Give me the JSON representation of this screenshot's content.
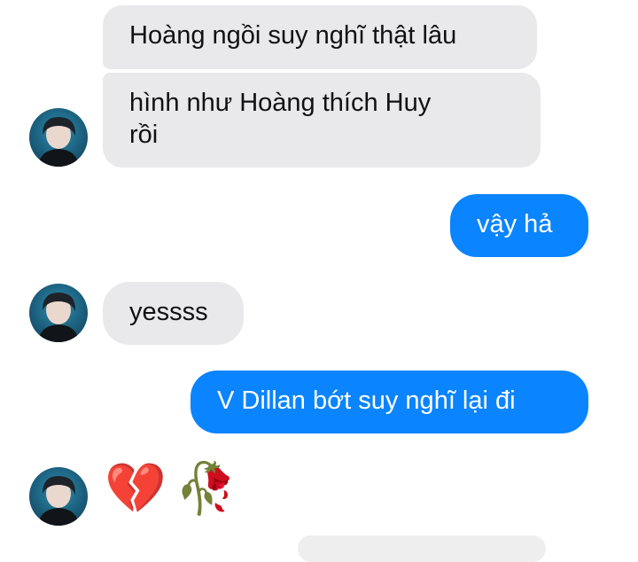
{
  "colors": {
    "accent": "#0a84ff",
    "incoming_bg": "#e9e9eb"
  },
  "messages": [
    {
      "id": "m1",
      "side": "incoming",
      "text": "Hoàng ngồi suy nghĩ thật lâu"
    },
    {
      "id": "m2",
      "side": "incoming",
      "text": "hình như Hoàng thích Huy\nrồi"
    },
    {
      "id": "m3",
      "side": "outgoing",
      "text": "vậy hả"
    },
    {
      "id": "m4",
      "side": "incoming",
      "text": "yessss"
    },
    {
      "id": "m5",
      "side": "outgoing",
      "text": "V Dillan bớt suy nghĩ lại đi"
    }
  ],
  "reactions": {
    "emojis": [
      "💔",
      "🥀"
    ],
    "icon_names": [
      "broken-heart-icon",
      "wilted-rose-icon"
    ]
  },
  "avatar": {
    "icon_name": "contact-avatar"
  }
}
